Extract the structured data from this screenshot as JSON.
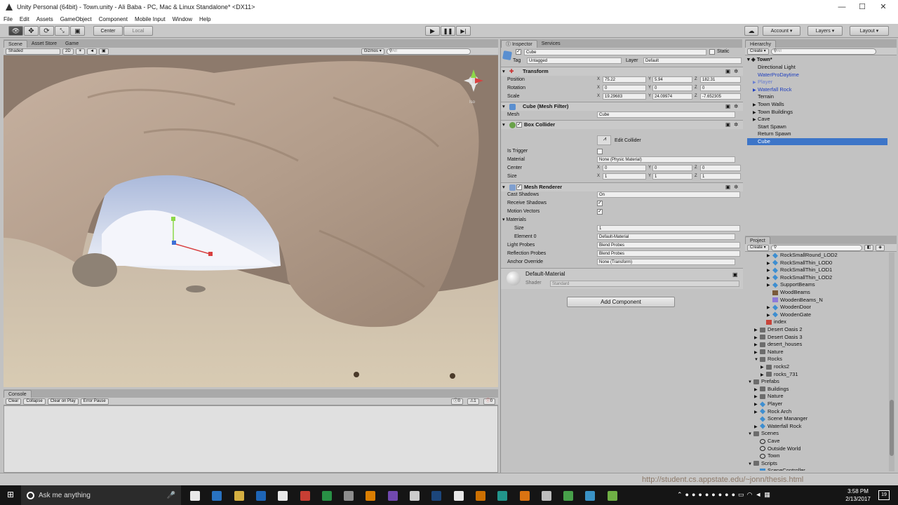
{
  "window": {
    "title": "Unity Personal (64bit) - Town.unity - Ali Baba - PC, Mac & Linux Standalone* <DX11>",
    "controls": [
      "—",
      "☐",
      "✕"
    ]
  },
  "menu": [
    "File",
    "Edit",
    "Assets",
    "GameObject",
    "Component",
    "Mobile Input",
    "Window",
    "Help"
  ],
  "toolbar": {
    "pivot": "Center",
    "space": "Local",
    "cloud": "☁",
    "account": "Account",
    "layers": "Layers",
    "layout": "Layout"
  },
  "scene": {
    "tabs": [
      "Scene",
      "Asset Store",
      "Game"
    ],
    "shading": "Shaded",
    "mode2d": "2D",
    "gizmos": "Gizmos",
    "search": "All",
    "gizmo_label": "Iso"
  },
  "console": {
    "tab": "Console",
    "buttons": [
      "Clear",
      "Collapse",
      "Clear on Play",
      "Error Pause"
    ],
    "warnings": "0",
    "errors_count": "1",
    "messages_count": "0"
  },
  "inspector": {
    "tabs": [
      "Inspector",
      "Services"
    ],
    "object_name": "Cube",
    "static_label": "Static",
    "tag_label": "Tag",
    "tag": "Untagged",
    "layer_label": "Layer",
    "layer": "Default",
    "transform": {
      "title": "Transform",
      "position_label": "Position",
      "position": [
        "75.22",
        "5.94",
        "182.31"
      ],
      "rotation_label": "Rotation",
      "rotation": [
        "0",
        "0",
        "0"
      ],
      "scale_label": "Scale",
      "scale": [
        "19.29683",
        "24.09974",
        "-7.652305"
      ]
    },
    "mesh_filter": {
      "title": "Cube (Mesh Filter)",
      "mesh_label": "Mesh",
      "mesh": "Cube"
    },
    "box_collider": {
      "title": "Box Collider",
      "edit": "Edit Collider",
      "trigger_label": "Is Trigger",
      "material_label": "Material",
      "material": "None (Physic Material)",
      "center_label": "Center",
      "center": [
        "0",
        "0",
        "0"
      ],
      "size_label": "Size",
      "size": [
        "1",
        "1",
        "1"
      ]
    },
    "mesh_renderer": {
      "title": "Mesh Renderer",
      "cast_label": "Cast Shadows",
      "cast": "On",
      "receive_label": "Receive Shadows",
      "motion_label": "Motion Vectors",
      "materials_label": "Materials",
      "size_label": "Size",
      "size": "1",
      "element_label": "Element 0",
      "element": "Default-Material",
      "light_label": "Light Probes",
      "light": "Blend Probes",
      "reflection_label": "Reflection Probes",
      "reflection": "Blend Probes",
      "anchor_label": "Anchor Override",
      "anchor": "None (Transform)"
    },
    "material": {
      "name": "Default-Material",
      "shader_label": "Shader",
      "shader": "Standard"
    },
    "add_component": "Add Component",
    "axis": [
      "X",
      "Y",
      "Z"
    ]
  },
  "hierarchy": {
    "tab": "Hierarchy",
    "create": "Create",
    "search": "All",
    "scene": "Town*",
    "items": [
      {
        "label": "Directional Light",
        "color": "#111111",
        "arrow": ""
      },
      {
        "label": "WaterProDaytime",
        "color": "#1f3fbf",
        "arrow": ""
      },
      {
        "label": "Player",
        "color": "#6a7fd0",
        "arrow": "▶"
      },
      {
        "label": "Waterfall Rock",
        "color": "#1f3fbf",
        "arrow": "▶"
      },
      {
        "label": "Terrain",
        "color": "#111111",
        "arrow": ""
      },
      {
        "label": "Town Walls",
        "color": "#111111",
        "arrow": "▶"
      },
      {
        "label": "Town Buildings",
        "color": "#111111",
        "arrow": "▶"
      },
      {
        "label": "Cave",
        "color": "#111111",
        "arrow": "▶"
      },
      {
        "label": "Start Spawn",
        "color": "#111111",
        "arrow": ""
      },
      {
        "label": "Return Spawn",
        "color": "#111111",
        "arrow": ""
      },
      {
        "label": "Cube",
        "color": "#ffffff",
        "arrow": ""
      }
    ]
  },
  "project": {
    "tab": "Project",
    "create": "Create",
    "items": [
      {
        "label": "RockSmallRound_LOD2",
        "kind": "cube",
        "arrow": "▶",
        "indent": 3
      },
      {
        "label": "RockSmallThin_LOD0",
        "kind": "cube",
        "arrow": "▶",
        "indent": 3
      },
      {
        "label": "RockSmallThin_LOD1",
        "kind": "cube",
        "arrow": "▶",
        "indent": 3
      },
      {
        "label": "RockSmallThin_LOD2",
        "kind": "cube",
        "arrow": "▶",
        "indent": 3
      },
      {
        "label": "SupportBeams",
        "kind": "cube",
        "arrow": "▶",
        "indent": 3
      },
      {
        "label": "WoodBeams",
        "kind": "tex",
        "arrow": "",
        "indent": 3
      },
      {
        "label": "WoodenBeams_N",
        "kind": "texn",
        "arrow": "",
        "indent": 3
      },
      {
        "label": "WoodenDoor",
        "kind": "cube",
        "arrow": "▶",
        "indent": 3
      },
      {
        "label": "WoodenGate",
        "kind": "cube",
        "arrow": "▶",
        "indent": 3
      },
      {
        "label": "index",
        "kind": "file",
        "arrow": "",
        "indent": 2
      },
      {
        "label": "Desert Oasis 2",
        "kind": "folder",
        "arrow": "▶",
        "indent": 1
      },
      {
        "label": "Desert Oasis 3",
        "kind": "folder",
        "arrow": "▶",
        "indent": 1
      },
      {
        "label": "desert_houses",
        "kind": "folder",
        "arrow": "▶",
        "indent": 1
      },
      {
        "label": "Nature",
        "kind": "folder",
        "arrow": "▶",
        "indent": 1
      },
      {
        "label": "Rocks",
        "kind": "folder",
        "arrow": "▼",
        "indent": 1
      },
      {
        "label": "rocks2",
        "kind": "folder",
        "arrow": "▶",
        "indent": 2
      },
      {
        "label": "rocks_731",
        "kind": "folder",
        "arrow": "▶",
        "indent": 2
      },
      {
        "label": "Prefabs",
        "kind": "folder",
        "arrow": "▼",
        "indent": 0
      },
      {
        "label": "Buildings",
        "kind": "folder",
        "arrow": "▶",
        "indent": 1
      },
      {
        "label": "Nature",
        "kind": "folder",
        "arrow": "▶",
        "indent": 1
      },
      {
        "label": "Player",
        "kind": "cube",
        "arrow": "▶",
        "indent": 1
      },
      {
        "label": "Rock Arch",
        "kind": "cube",
        "arrow": "▶",
        "indent": 1
      },
      {
        "label": "Scene Mananger",
        "kind": "cube",
        "arrow": "",
        "indent": 1
      },
      {
        "label": "Waterfall Rock",
        "kind": "cube",
        "arrow": "▶",
        "indent": 1
      },
      {
        "label": "Scenes",
        "kind": "folder",
        "arrow": "▼",
        "indent": 0
      },
      {
        "label": "Cave",
        "kind": "unity",
        "arrow": "",
        "indent": 1
      },
      {
        "label": "Outside World",
        "kind": "unity",
        "arrow": "",
        "indent": 1
      },
      {
        "label": "Town",
        "kind": "unity",
        "arrow": "",
        "indent": 1
      },
      {
        "label": "Scripts",
        "kind": "folder",
        "arrow": "▼",
        "indent": 0
      },
      {
        "label": "SceneController",
        "kind": "script",
        "arrow": "",
        "indent": 1
      }
    ]
  },
  "overlay_text": "http://student.cs.appstate.edu/~jonn/thesis.html",
  "taskbar": {
    "search": "Ask me anything",
    "time": "3:58 PM",
    "date": "2/13/2017",
    "notifications": "19",
    "apps": [
      {
        "name": "task-view-icon",
        "color": "#ffffff"
      },
      {
        "name": "edge-icon",
        "color": "#2b7cd3"
      },
      {
        "name": "explorer-icon",
        "color": "#e9c046"
      },
      {
        "name": "outlook-icon",
        "color": "#1f6ec8"
      },
      {
        "name": "store-icon",
        "color": "#ffffff"
      },
      {
        "name": "chrome-icon",
        "color": "#db4437"
      },
      {
        "name": "terminal-icon",
        "color": "#2a9d4a"
      },
      {
        "name": "app-icon-1",
        "color": "#9a9a9a"
      },
      {
        "name": "vlc-icon",
        "color": "#f08a00"
      },
      {
        "name": "vs-icon",
        "color": "#7b4fc0"
      },
      {
        "name": "unity-icon",
        "color": "#e0e0e0"
      },
      {
        "name": "photoshop-icon",
        "color": "#1d4b86"
      },
      {
        "name": "search-app-icon",
        "color": "#ffffff"
      },
      {
        "name": "illustrator-icon",
        "color": "#e07a00"
      },
      {
        "name": "maya-icon",
        "color": "#24a398"
      },
      {
        "name": "blender-icon",
        "color": "#ef7d12"
      },
      {
        "name": "app-icon-2",
        "color": "#cfcfcf"
      },
      {
        "name": "app-icon-3",
        "color": "#4caf50"
      },
      {
        "name": "app-icon-4",
        "color": "#3ea0d8"
      },
      {
        "name": "notepad-icon",
        "color": "#79c04a"
      }
    ]
  }
}
